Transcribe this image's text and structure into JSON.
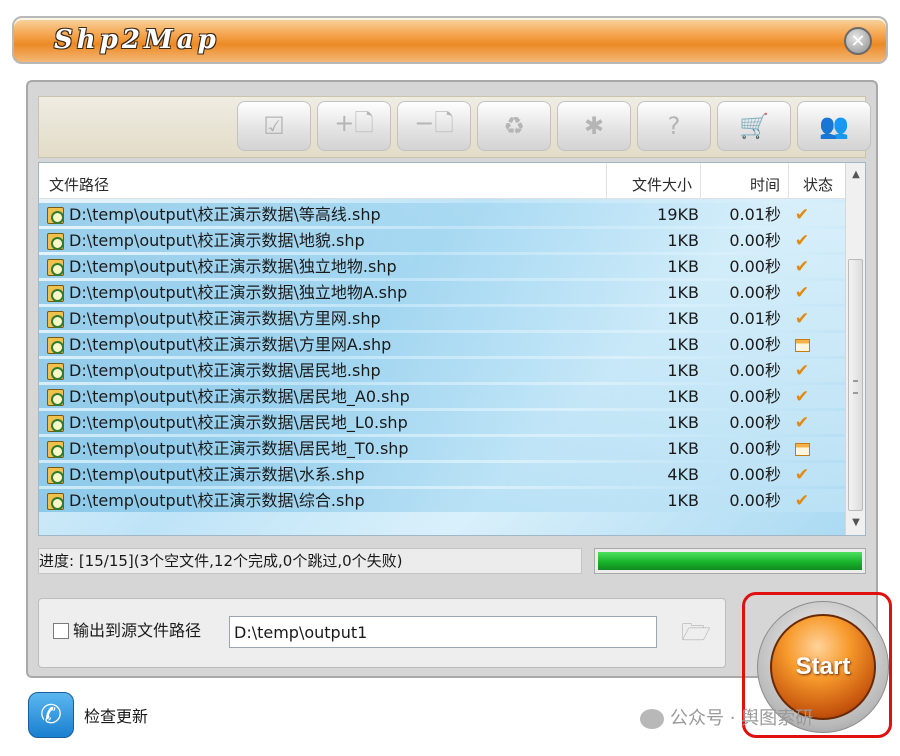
{
  "app": {
    "title": "Shp2Map"
  },
  "toolbar": {
    "buttons": [
      {
        "name": "open-folder-icon",
        "glyph": "☑"
      },
      {
        "name": "add-file-icon",
        "glyph": "+🗋"
      },
      {
        "name": "remove-file-icon",
        "glyph": "−🗋"
      },
      {
        "name": "trash-icon",
        "glyph": "♻"
      },
      {
        "name": "gear-icon",
        "glyph": "✱"
      },
      {
        "name": "help-icon",
        "glyph": "?"
      },
      {
        "name": "cart-icon",
        "glyph": "🛒"
      },
      {
        "name": "users-icon",
        "glyph": "👥"
      }
    ]
  },
  "list": {
    "headers": {
      "path": "文件路径",
      "size": "文件大小",
      "time": "时间",
      "status": "状态"
    },
    "rows": [
      {
        "path": "D:\\temp\\output\\校正演示数据\\等高线.shp",
        "size": "19KB",
        "time": "0.01秒",
        "status": "done"
      },
      {
        "path": "D:\\temp\\output\\校正演示数据\\地貌.shp",
        "size": "1KB",
        "time": "0.00秒",
        "status": "done"
      },
      {
        "path": "D:\\temp\\output\\校正演示数据\\独立地物.shp",
        "size": "1KB",
        "time": "0.00秒",
        "status": "done"
      },
      {
        "path": "D:\\temp\\output\\校正演示数据\\独立地物A.shp",
        "size": "1KB",
        "time": "0.00秒",
        "status": "done"
      },
      {
        "path": "D:\\temp\\output\\校正演示数据\\方里网.shp",
        "size": "1KB",
        "time": "0.01秒",
        "status": "done"
      },
      {
        "path": "D:\\temp\\output\\校正演示数据\\方里网A.shp",
        "size": "1KB",
        "time": "0.00秒",
        "status": "empty"
      },
      {
        "path": "D:\\temp\\output\\校正演示数据\\居民地.shp",
        "size": "1KB",
        "time": "0.00秒",
        "status": "done"
      },
      {
        "path": "D:\\temp\\output\\校正演示数据\\居民地_A0.shp",
        "size": "1KB",
        "time": "0.00秒",
        "status": "done"
      },
      {
        "path": "D:\\temp\\output\\校正演示数据\\居民地_L0.shp",
        "size": "1KB",
        "time": "0.00秒",
        "status": "done"
      },
      {
        "path": "D:\\temp\\output\\校正演示数据\\居民地_T0.shp",
        "size": "1KB",
        "time": "0.00秒",
        "status": "empty"
      },
      {
        "path": "D:\\temp\\output\\校正演示数据\\水系.shp",
        "size": "4KB",
        "time": "0.00秒",
        "status": "done"
      },
      {
        "path": "D:\\temp\\output\\校正演示数据\\综合.shp",
        "size": "1KB",
        "time": "0.00秒",
        "status": "done"
      }
    ]
  },
  "progress": {
    "text": "进度: [15/15](3个空文件,12个完成,0个跳过,0个失败)",
    "fraction": 1.0
  },
  "output": {
    "checkbox_label": "输出到源文件路径",
    "checked": false,
    "path_value": "D:\\temp\\output1"
  },
  "start": {
    "label": "Start"
  },
  "update": {
    "label": "检查更新"
  },
  "watermark": {
    "text": "公众号 · 舆图索研"
  },
  "colors": {
    "accent": "#ec8a25",
    "progress": "#19b52b",
    "highlight": "#e01010"
  }
}
